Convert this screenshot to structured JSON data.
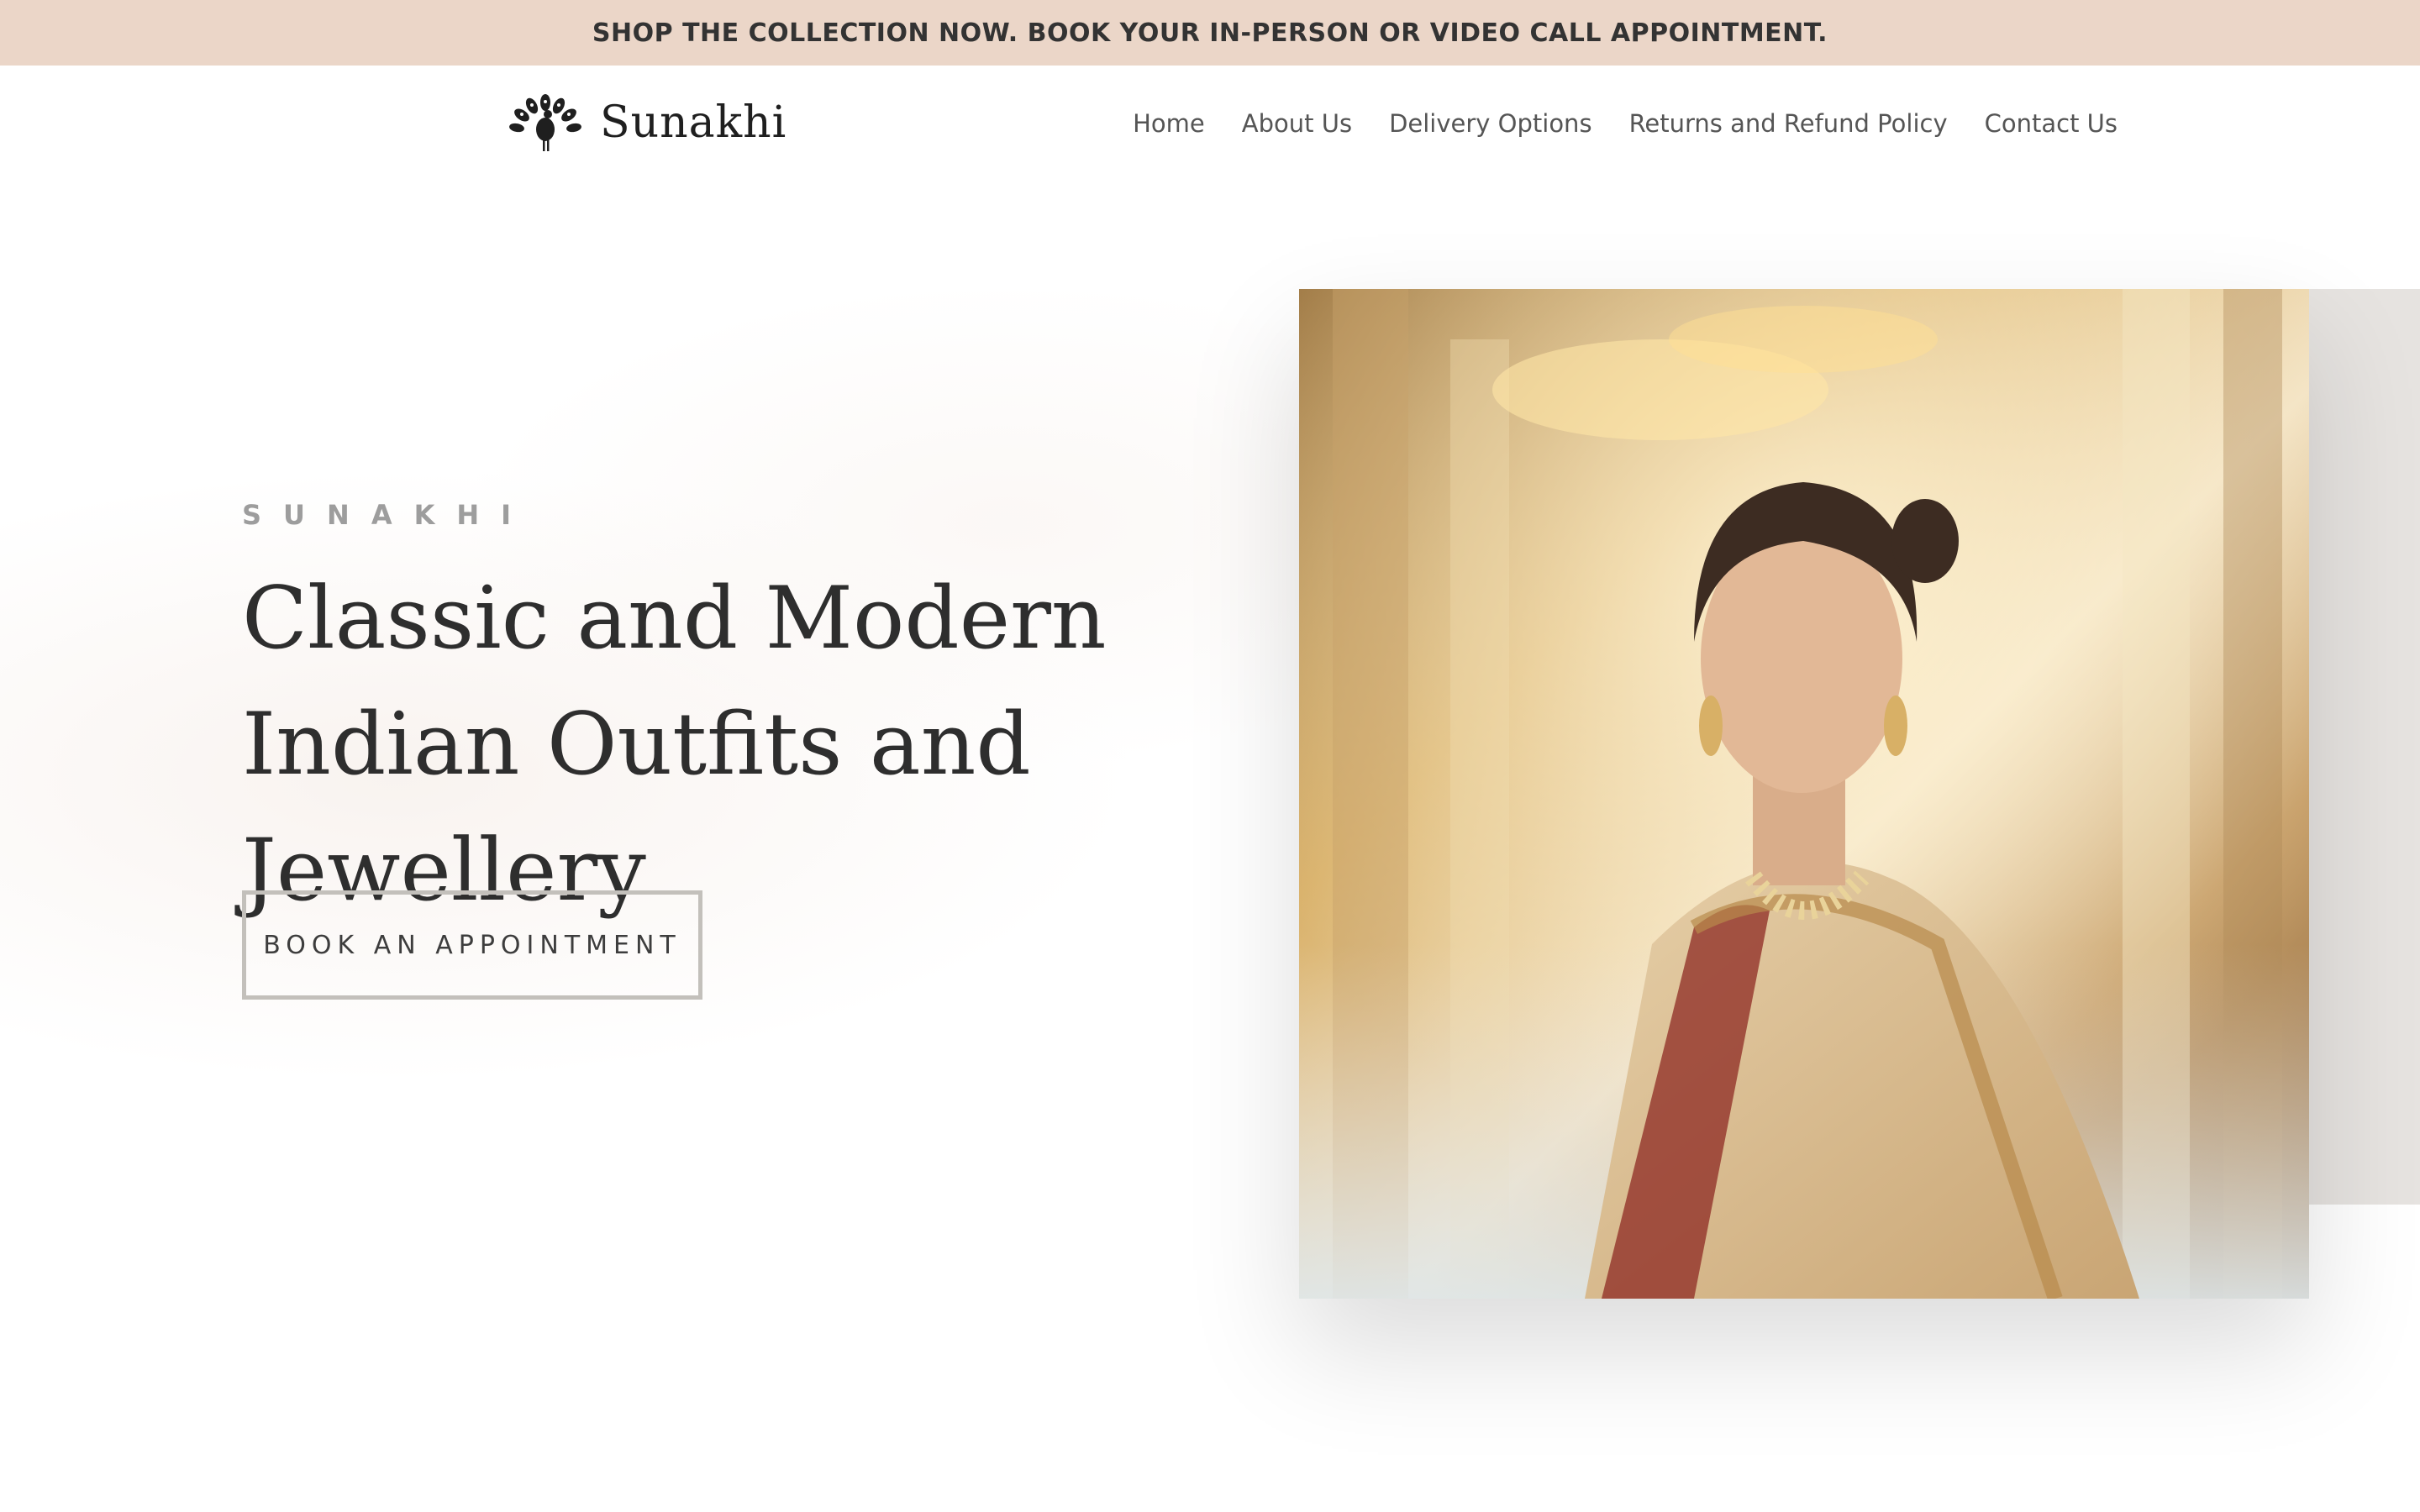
{
  "announcement": {
    "text": "SHOP THE COLLECTION NOW. BOOK YOUR IN-PERSON OR VIDEO CALL APPOINTMENT."
  },
  "header": {
    "logo": {
      "text": "Sunakhi",
      "icon": "peacock-icon"
    },
    "nav": [
      {
        "label": "Home"
      },
      {
        "label": "About Us"
      },
      {
        "label": "Delivery Options"
      },
      {
        "label": "Returns and Refund Policy"
      },
      {
        "label": "Contact Us"
      }
    ]
  },
  "hero": {
    "eyebrow": "SUNAKHI",
    "title": "Classic and Modern Indian Outfits and Jewellery",
    "cta_label": "BOOK AN APPOINTMENT"
  },
  "colors": {
    "announcement_bg": "#ebd6c8",
    "text_dark": "#2e2e2e",
    "nav_text": "#555555",
    "button_border": "#c3c0bb"
  }
}
